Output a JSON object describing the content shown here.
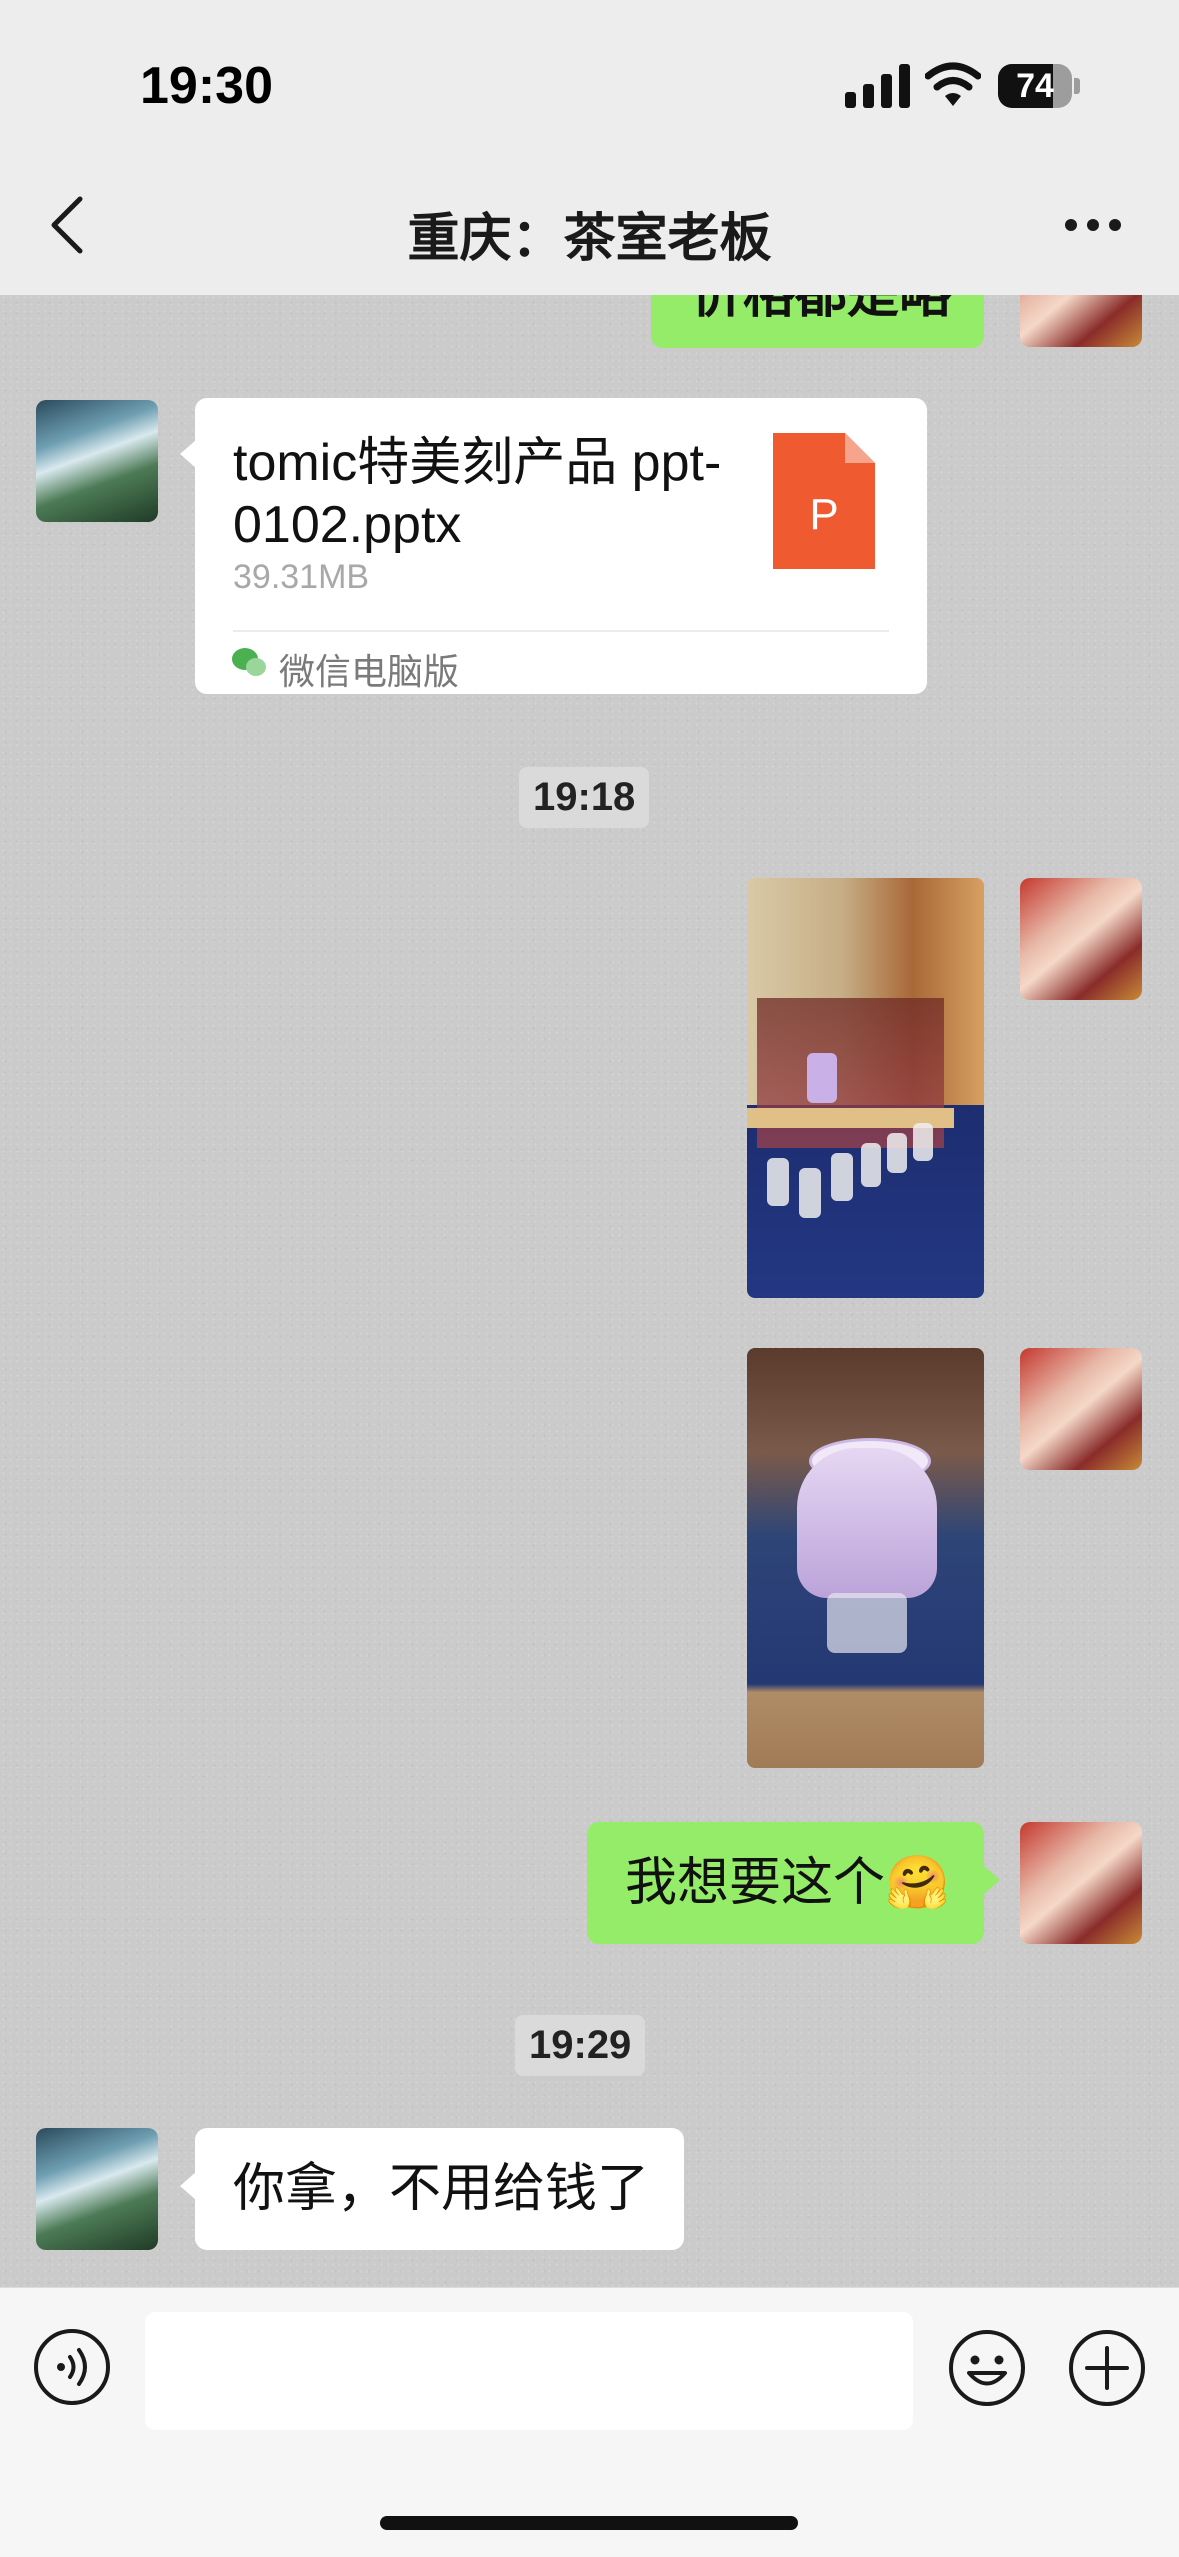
{
  "status_bar": {
    "time": "19:30",
    "battery_level": "74"
  },
  "nav": {
    "title": "重庆：茶室老板"
  },
  "messages": {
    "partial_top_text": "价格都是略",
    "file": {
      "name": "tomic特美刻产品 ppt-0102.pptx",
      "size": "39.31MB",
      "source": "微信电脑版",
      "icon_letter": "P"
    },
    "timestamp_1": "19:18",
    "outgoing_text": "我想要这个🤗",
    "timestamp_2": "19:29",
    "incoming_text": "你拿，不用给钱了"
  },
  "colors": {
    "bubble_green": "#95ec69",
    "bubble_white": "#ffffff",
    "file_icon": "#f05a30"
  },
  "icons": [
    "back-icon",
    "more-icon",
    "signal-icon",
    "wifi-icon",
    "battery-icon",
    "voice-icon",
    "emoji-icon",
    "plus-icon",
    "ppt-file-icon",
    "wechat-icon"
  ]
}
